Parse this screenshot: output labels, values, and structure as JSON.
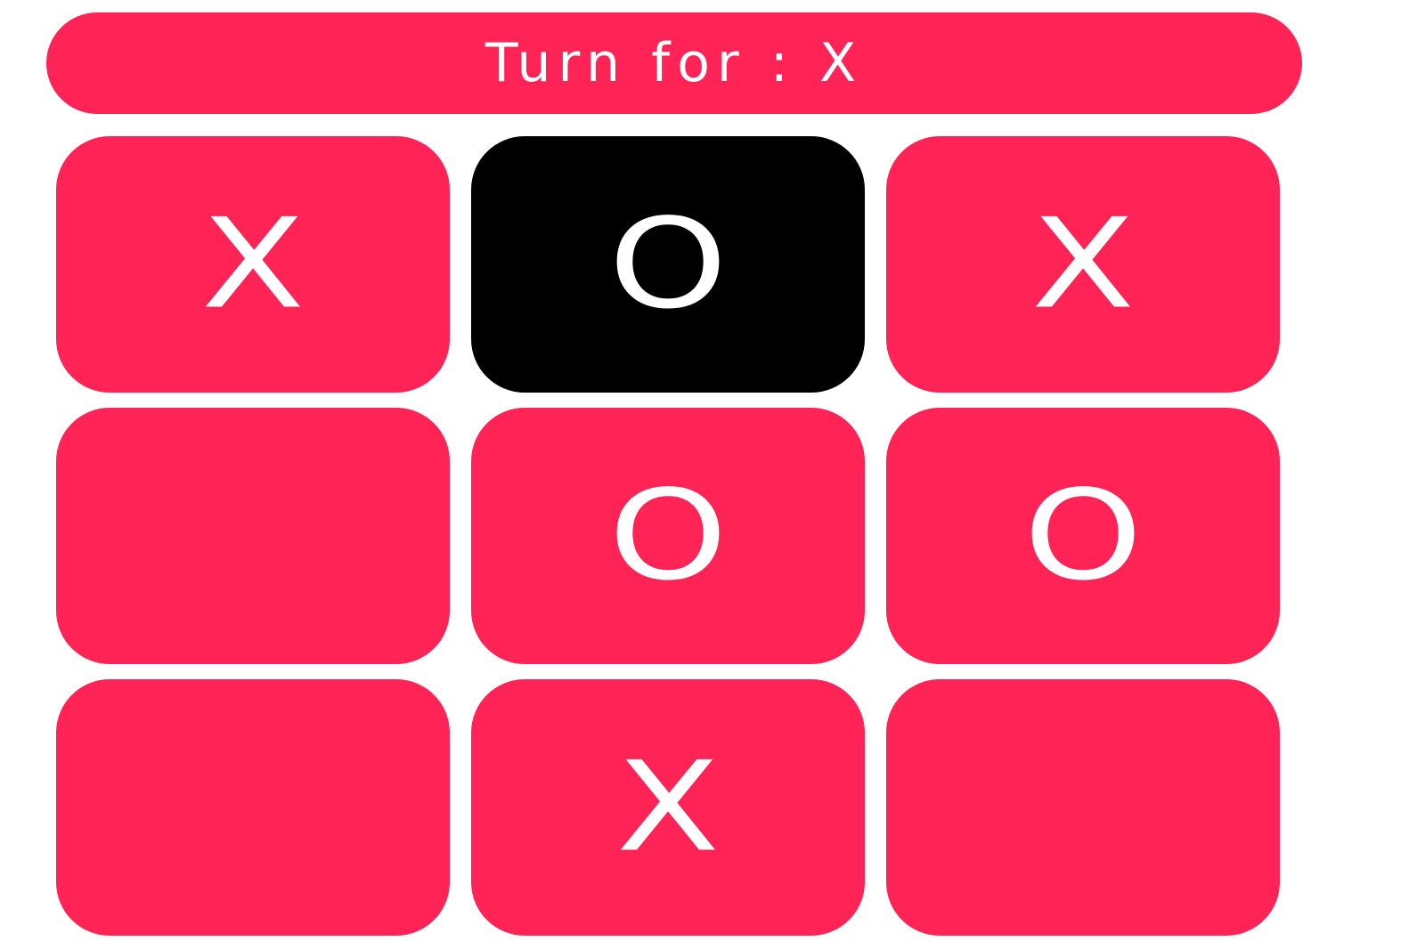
{
  "turn": {
    "label": "Turn for : X"
  },
  "board": {
    "cells": [
      {
        "mark": "X",
        "highlighted": false
      },
      {
        "mark": "O",
        "highlighted": true
      },
      {
        "mark": "X",
        "highlighted": false
      },
      {
        "mark": "",
        "highlighted": false
      },
      {
        "mark": "O",
        "highlighted": false
      },
      {
        "mark": "O",
        "highlighted": false
      },
      {
        "mark": "",
        "highlighted": false
      },
      {
        "mark": "X",
        "highlighted": false
      },
      {
        "mark": "",
        "highlighted": false
      }
    ]
  },
  "colors": {
    "accent": "#ff2455",
    "highlight": "#000000",
    "mark": "#ffffff",
    "background": "#ffffff"
  }
}
